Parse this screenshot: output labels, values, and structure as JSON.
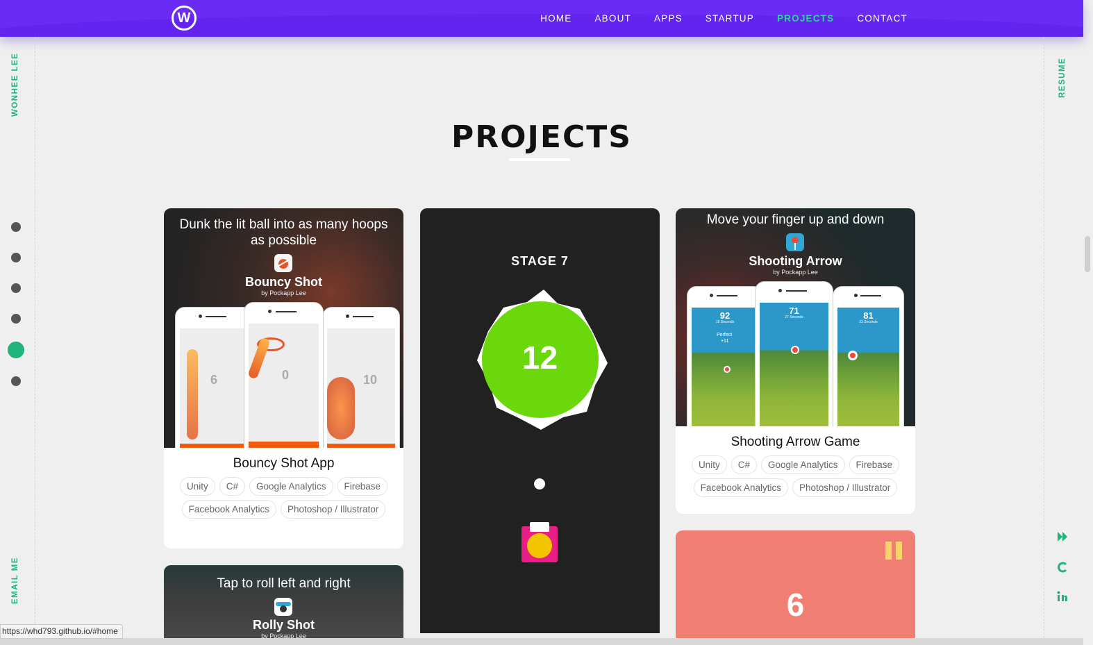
{
  "header": {
    "logo_letter": "W",
    "nav": [
      "HOME",
      "ABOUT",
      "APPS",
      "STARTUP",
      "PROJECTS",
      "CONTACT"
    ],
    "active": "PROJECTS",
    "colors": {
      "bar": "#6a2cf5",
      "accent": "#2ed39a"
    }
  },
  "sidebar": {
    "name": "WONHEE LEE",
    "email": "EMAIL ME",
    "resume": "RESUME",
    "section_dots": 6,
    "active_dot": 5,
    "social_icons": [
      "medium-icon",
      "codepen-icon",
      "linkedin-icon"
    ]
  },
  "page_title": "PROJECTS",
  "cards": {
    "bouncy": {
      "tagline": "Dunk the lit ball into as many hoops as possible",
      "app_name": "Bouncy Shot",
      "by": "by Pockapp Lee",
      "scores": [
        "6",
        "0",
        "10"
      ],
      "title": "Bouncy Shot App",
      "chips": [
        "Unity",
        "C#",
        "Google Analytics",
        "Firebase",
        "Facebook Analytics",
        "Photoshop / Illustrator"
      ]
    },
    "stage": {
      "stage_label": "STAGE 7",
      "count": "12"
    },
    "arrow": {
      "tagline": "Move your finger up and down",
      "app_name": "Shooting Arrow",
      "by": "by Pockapp Lee",
      "scores": [
        "92",
        "71",
        "81"
      ],
      "subs": [
        "18 Seconds",
        "27 Seconds",
        "23 Seconds"
      ],
      "perfect": "Perfect",
      "bonus": "+11",
      "title": "Shooting Arrow Game",
      "chips": [
        "Unity",
        "C#",
        "Google Analytics",
        "Firebase",
        "Facebook Analytics",
        "Photoshop / Illustrator"
      ]
    },
    "rolly": {
      "tagline": "Tap to roll left and right",
      "app_name": "Rolly Shot",
      "by": "by Pockapp Lee"
    },
    "coral": {
      "score": "6"
    }
  },
  "status_url": "https://whd793.github.io/#home"
}
